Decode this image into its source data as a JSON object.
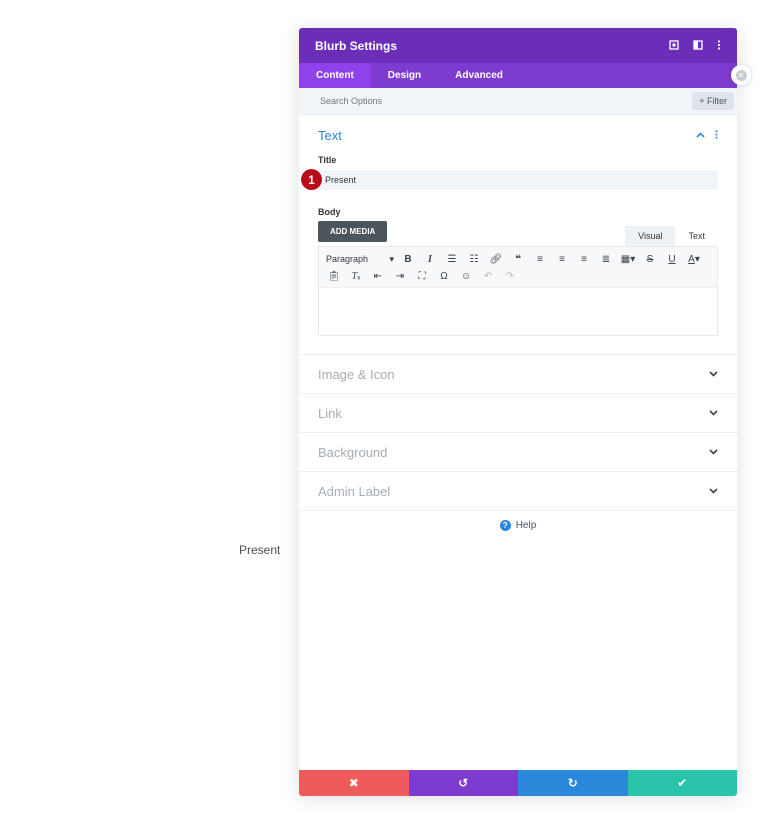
{
  "canvas": {
    "module_text": "Present"
  },
  "panel": {
    "title": "Blurb Settings",
    "tabs": [
      {
        "label": "Content",
        "active": true
      },
      {
        "label": "Design",
        "active": false
      },
      {
        "label": "Advanced",
        "active": false
      }
    ],
    "search": {
      "placeholder": "Search Options",
      "filter_label": "+ Filter"
    },
    "text_section": {
      "title": "Text",
      "title_label": "Title",
      "title_value": "Present",
      "badge": "1",
      "body_label": "Body",
      "add_media": "ADD MEDIA",
      "editor_tabs": [
        "Visual",
        "Text"
      ],
      "paragraph_select": "Paragraph"
    },
    "collapsed_sections": [
      "Image & Icon",
      "Link",
      "Background",
      "Admin Label"
    ],
    "help_label": "Help"
  },
  "colors": {
    "header": "#6c2eb9",
    "tabs": "#7e3bd0",
    "active_tab": "#8f42ec",
    "accent": "#2b87da",
    "cancel": "#ef5a5c",
    "undo": "#7e3bd0",
    "redo": "#2b87da",
    "save": "#29c4a9"
  }
}
